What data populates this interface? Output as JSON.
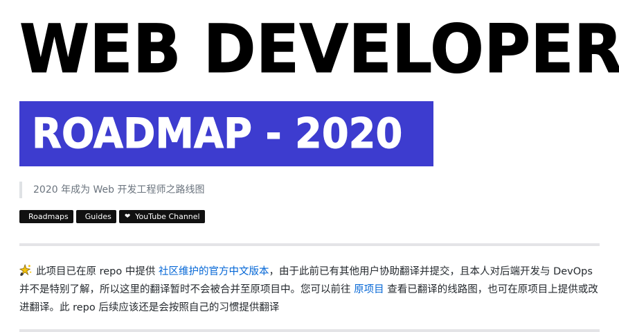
{
  "header": {
    "title": "WEB DEVELOPER",
    "subtitle": "ROADMAP - 2020",
    "accent_color": "#3d3ccf"
  },
  "quote": {
    "text": "2020 年成为 Web 开发工程师之路线图"
  },
  "badges": [
    {
      "label": "Roadmaps"
    },
    {
      "label": "Guides"
    },
    {
      "label": "YouTube Channel",
      "icon": "heart-icon"
    }
  ],
  "notice": {
    "icon": "sparkle-icon",
    "part1": "此项目已在原 repo 中提供 ",
    "link1": "社区维护的官方中文版本",
    "part2": "，由于此前已有其他用户协助翻译并提交，且本人对后端开发与 DevOps 并不是特别了解，所以这里的翻译暂时不会被合并至原项目中。您可以前往 ",
    "link2": "原项目",
    "part3": " 查看已翻译的线路图，也可在原项目上提供或改进翻译。此 repo 后续应该还是会按照自己的习惯提供翻译",
    "link_color": "#0366d6"
  }
}
